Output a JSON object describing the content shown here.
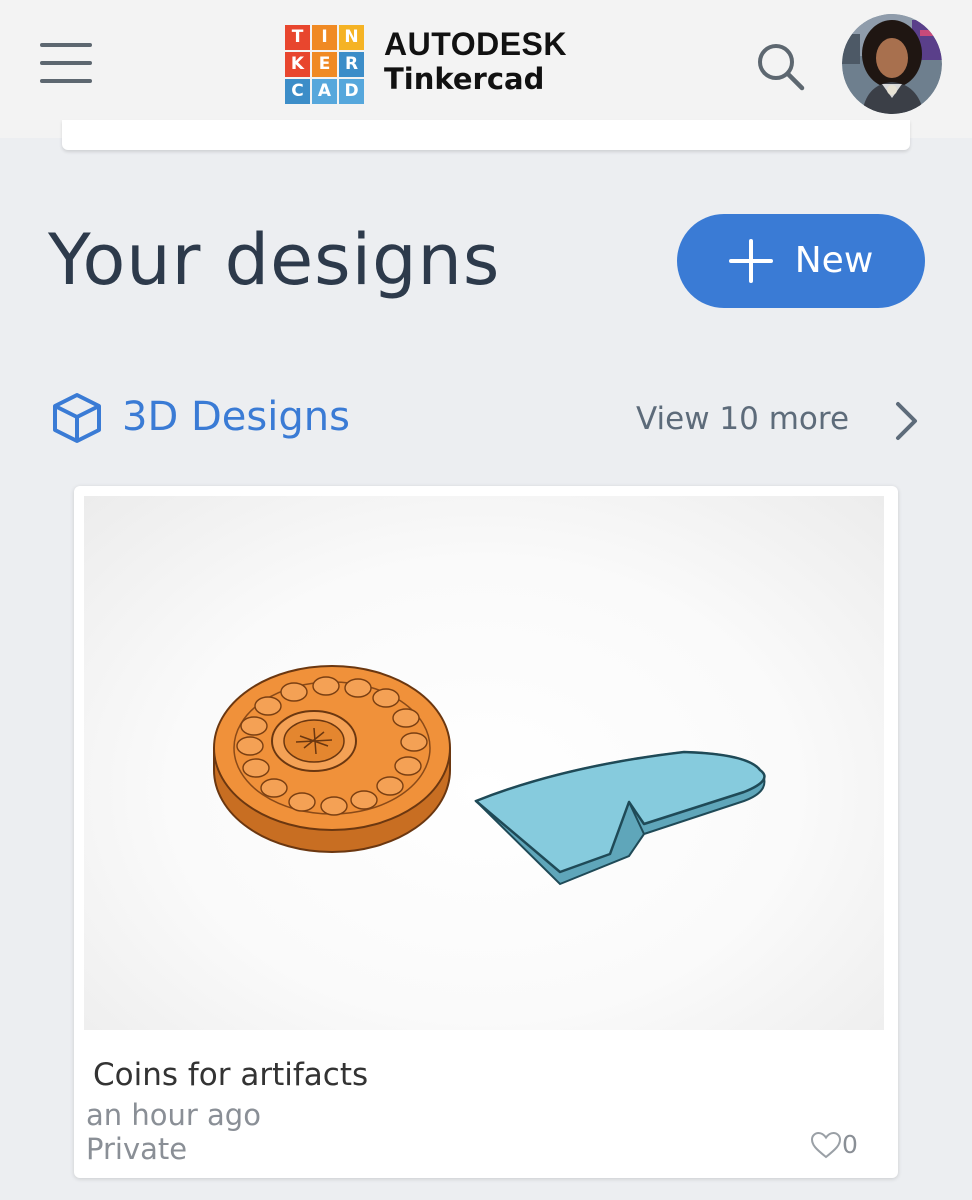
{
  "header": {
    "logo_letters": [
      "T",
      "I",
      "N",
      "K",
      "E",
      "R",
      "C",
      "A",
      "D"
    ],
    "logo_colors": [
      "#e8462e",
      "#f08a24",
      "#f5b324",
      "#e8462e",
      "#f08a24",
      "#3c8dc8",
      "#3c8dc8",
      "#56a7dc",
      "#56a7dc"
    ],
    "brand_company": "AUTODESK",
    "brand_product": "Tinkercad",
    "menu_icon": "hamburger-menu-icon",
    "search_icon": "search-icon",
    "avatar": "user-avatar"
  },
  "page": {
    "title": "Your designs",
    "new_button_label": "New"
  },
  "section": {
    "icon": "cube-icon",
    "title": "3D Designs",
    "view_more": "View 10 more"
  },
  "designs": [
    {
      "title": "Coins for artifacts",
      "updated": "an hour ago",
      "visibility": "Private",
      "likes": "0"
    }
  ],
  "colors": {
    "accent": "#3a7bd5",
    "title_text": "#2d3a4b",
    "page_bg": "#eceef1",
    "coin_orange": "#f0913a",
    "shape_blue": "#86cbdd"
  }
}
